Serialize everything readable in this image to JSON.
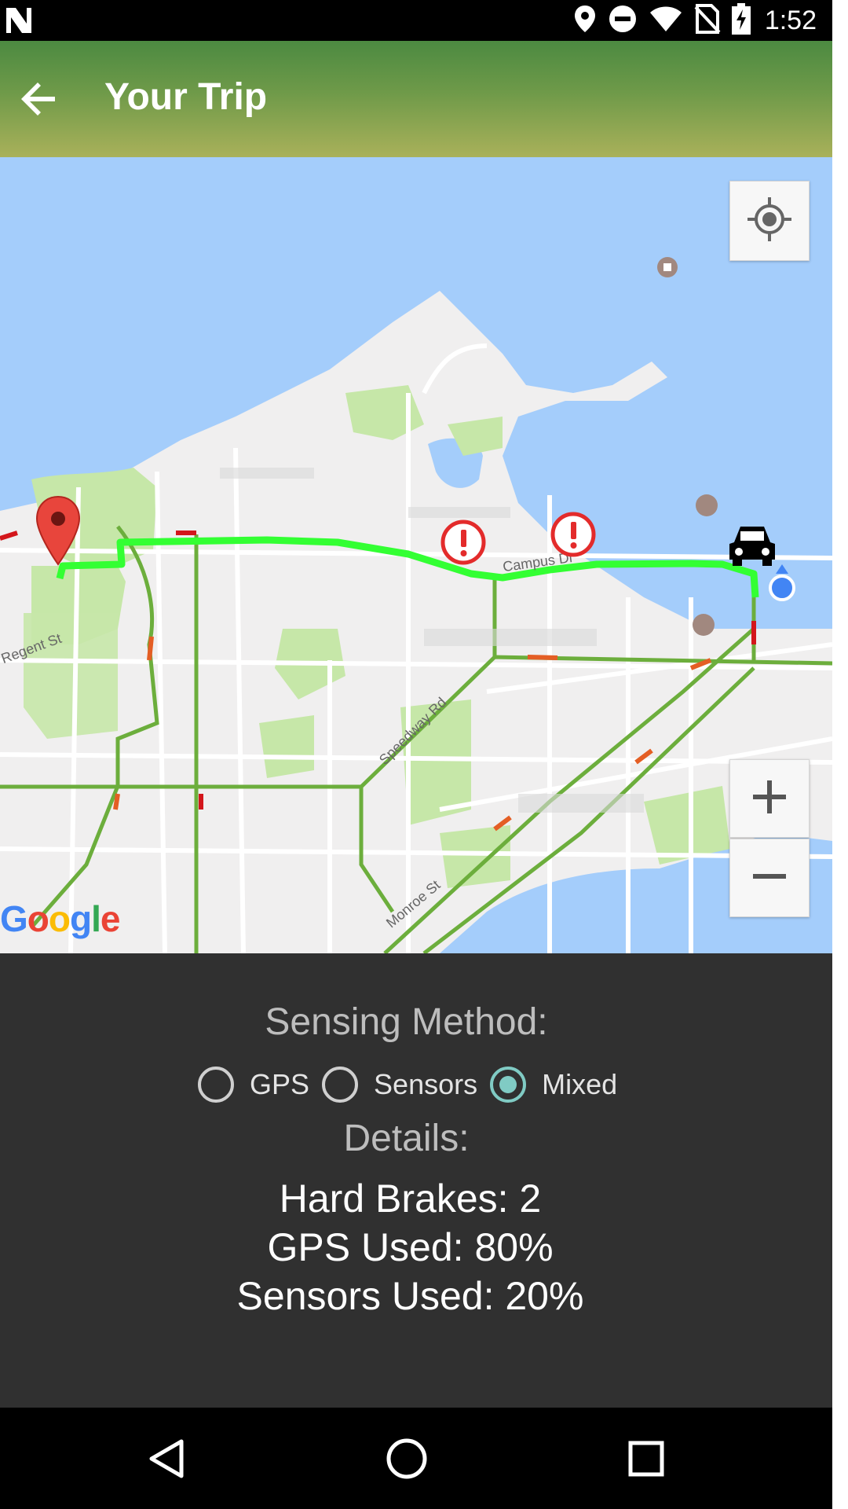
{
  "status_bar": {
    "time": "1:52",
    "icons": [
      "n-logo-icon",
      "location-icon",
      "do-not-disturb-icon",
      "wifi-icon",
      "no-sim-icon",
      "battery-charging-icon"
    ]
  },
  "app_bar": {
    "title": "Your Trip",
    "back_icon": "arrow-back-icon"
  },
  "map": {
    "provider_logo": "Google",
    "street_labels": [
      "Speedway Rd",
      "Campus Dr",
      "Monroe St",
      "Regent St"
    ],
    "route_color": "#33ff33",
    "markers": {
      "start": "red-pin-icon",
      "hard_brake": "alert-icon",
      "current": "car-icon",
      "my_location": "blue-dot-icon"
    },
    "controls": {
      "locate": "my-location-icon",
      "zoom_in": "+",
      "zoom_out": "−"
    }
  },
  "panel": {
    "sensing_title": "Sensing Method:",
    "options": [
      {
        "label": "GPS",
        "checked": false
      },
      {
        "label": "Sensors",
        "checked": false
      },
      {
        "label": "Mixed",
        "checked": true
      }
    ],
    "details_title": "Details:",
    "hard_brakes": "Hard Brakes: 2",
    "gps_used": "GPS Used: 80%",
    "sensors_used": "Sensors Used: 20%"
  },
  "nav_bar": {
    "back_icon": "nav-back-icon",
    "home_icon": "nav-home-icon",
    "recents_icon": "nav-recents-icon"
  },
  "colors": {
    "app_bar_top": "#4c8a41",
    "app_bar_bottom": "#a9b15a",
    "panel_bg": "#303030",
    "radio_accent": "#80cbc4",
    "water": "#a4cdfb",
    "park": "#c6e7a8"
  }
}
